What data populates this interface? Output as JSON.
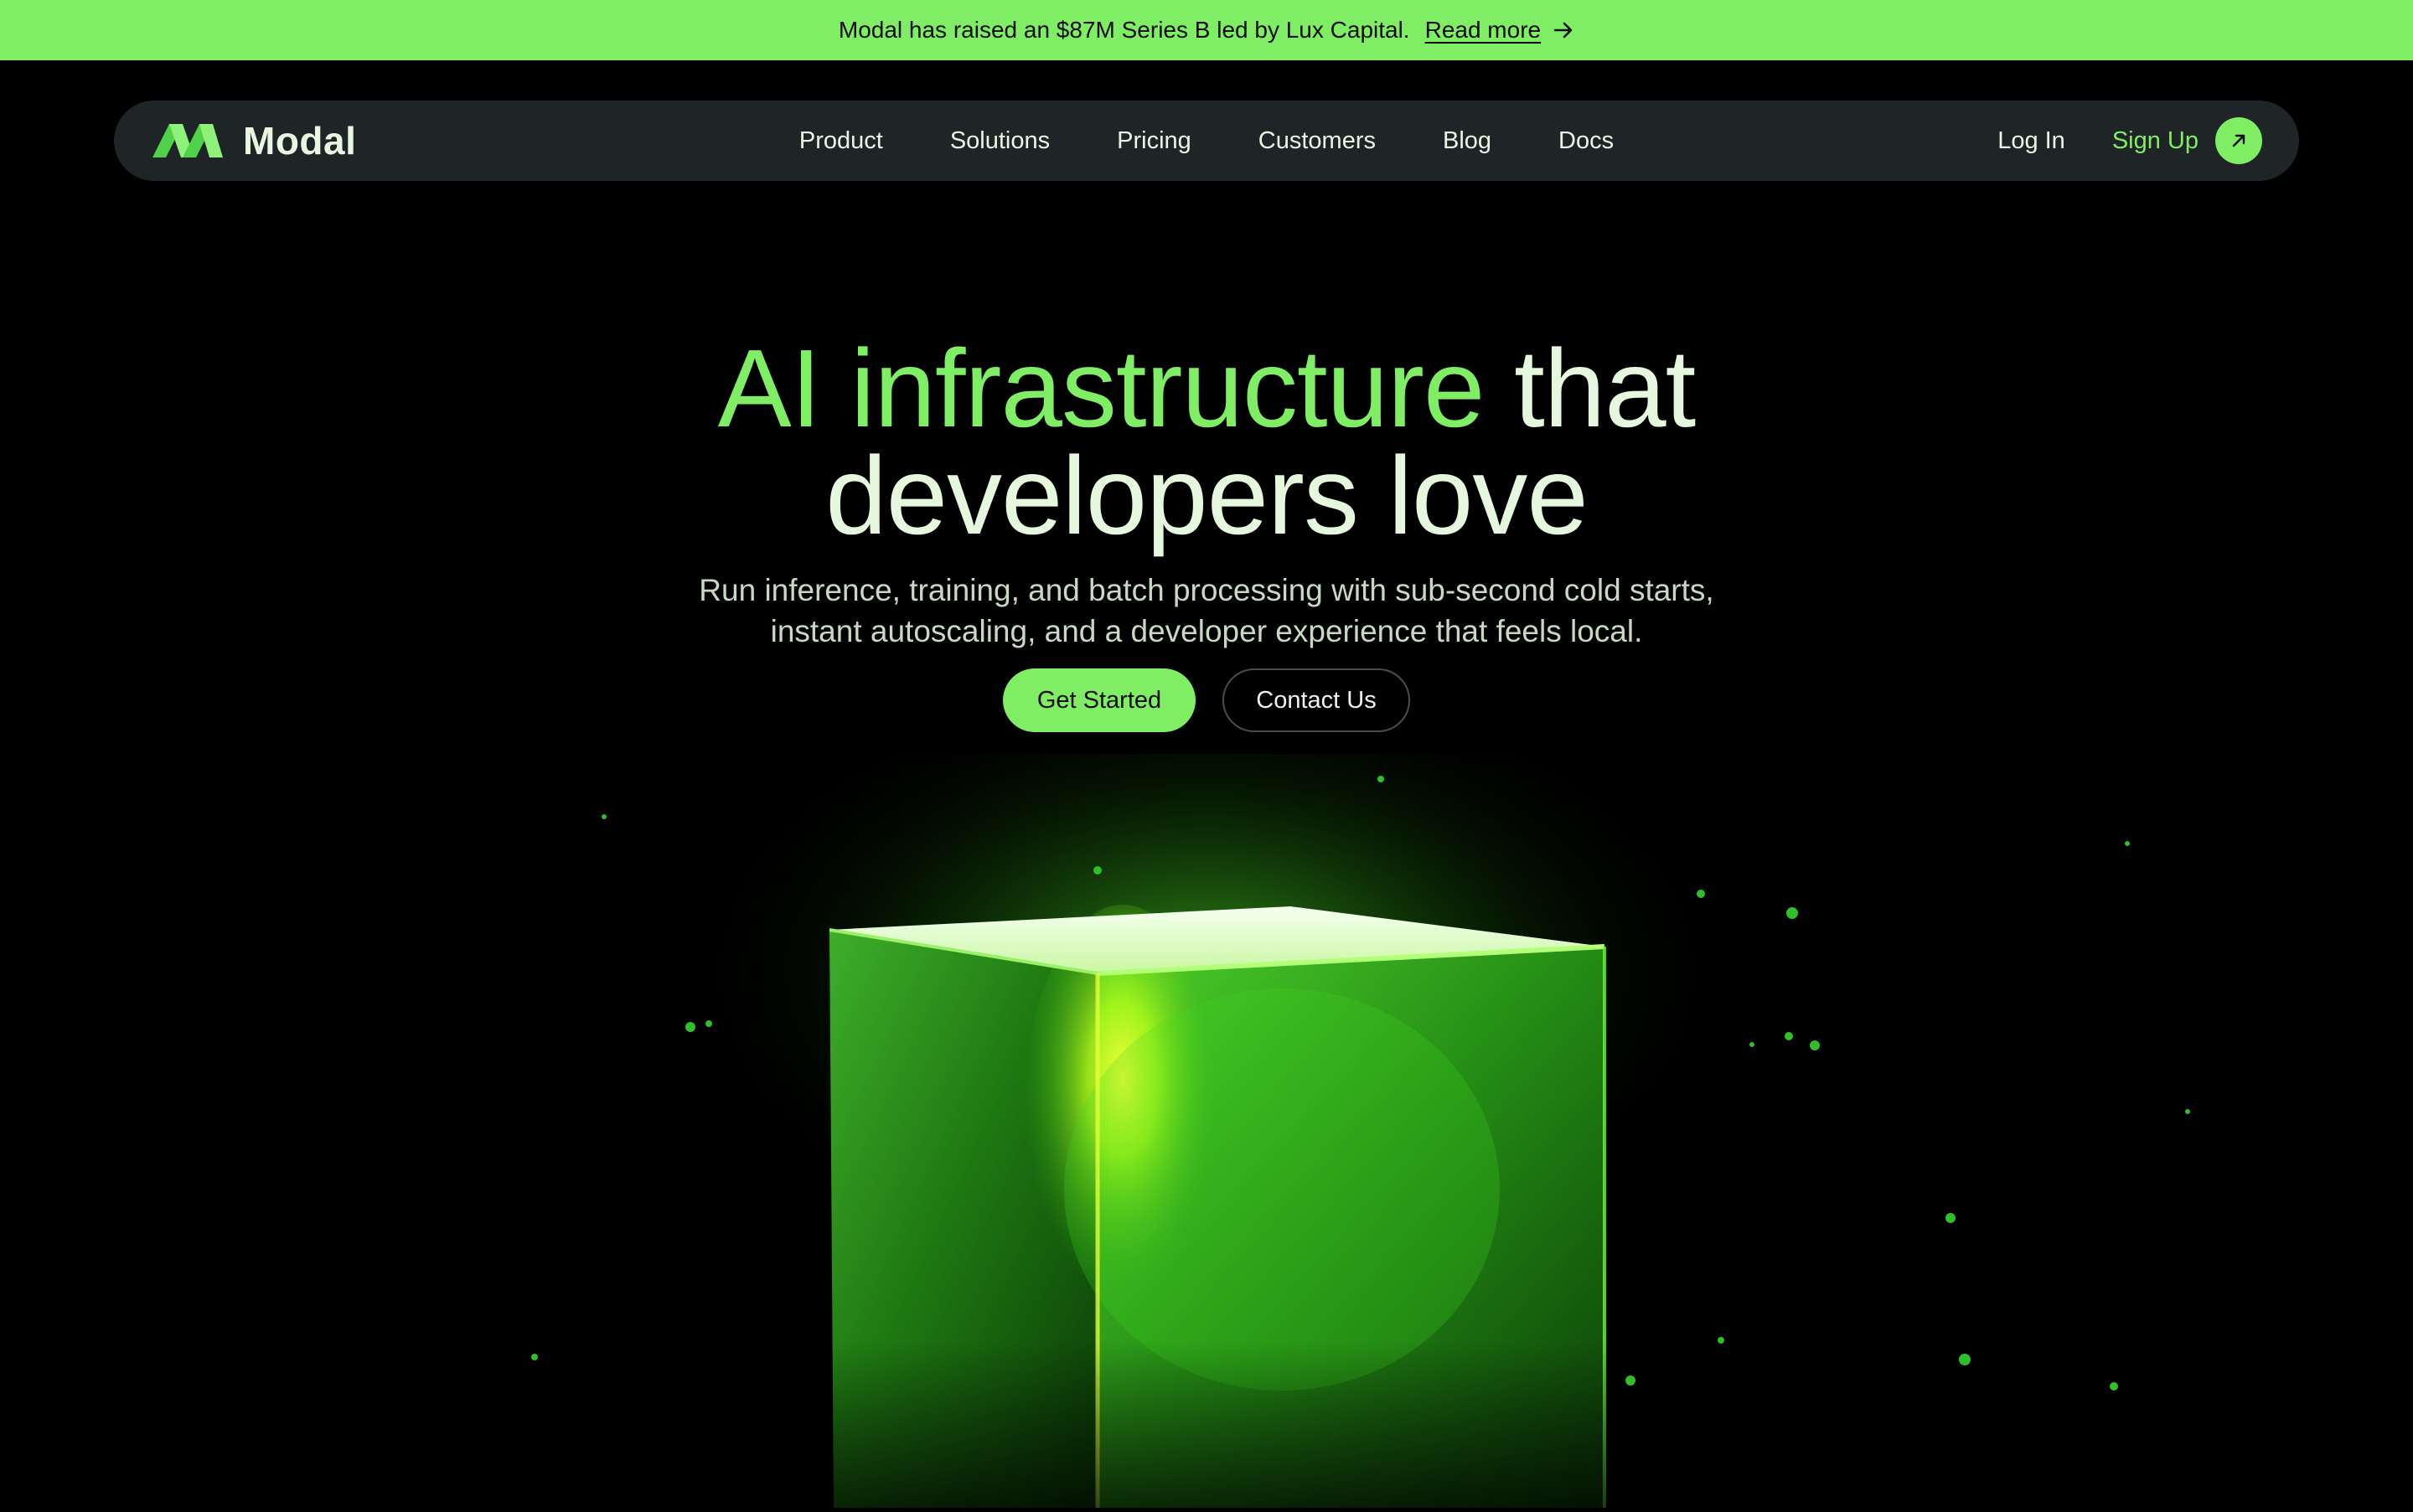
{
  "announcement": {
    "message": "Modal has raised an $87M Series B led by Lux Capital.",
    "link_label": "Read more",
    "link_icon": "arrow-right-icon",
    "background": "#7fee64"
  },
  "nav": {
    "brand": "Modal",
    "items": [
      {
        "label": "Product"
      },
      {
        "label": "Solutions"
      },
      {
        "label": "Pricing"
      },
      {
        "label": "Customers"
      },
      {
        "label": "Blog"
      },
      {
        "label": "Docs"
      }
    ],
    "login_label": "Log In",
    "signup_label": "Sign Up",
    "signup_icon": "arrow-up-right-icon"
  },
  "hero": {
    "headline_accent": "AI infrastructure",
    "headline_rest": "that",
    "headline_line2": "developers love",
    "subhead": "Run inference, training, and batch processing with sub-second cold starts, instant autoscaling, and a developer experience that feels local.",
    "primary_cta": "Get Started",
    "secondary_cta": "Contact Us"
  },
  "colors": {
    "accent": "#7fee64",
    "background": "#000000",
    "nav_background": "#1f2426",
    "headline": "#e5f8de"
  },
  "visual": {
    "icon": "glowing-green-cube"
  }
}
